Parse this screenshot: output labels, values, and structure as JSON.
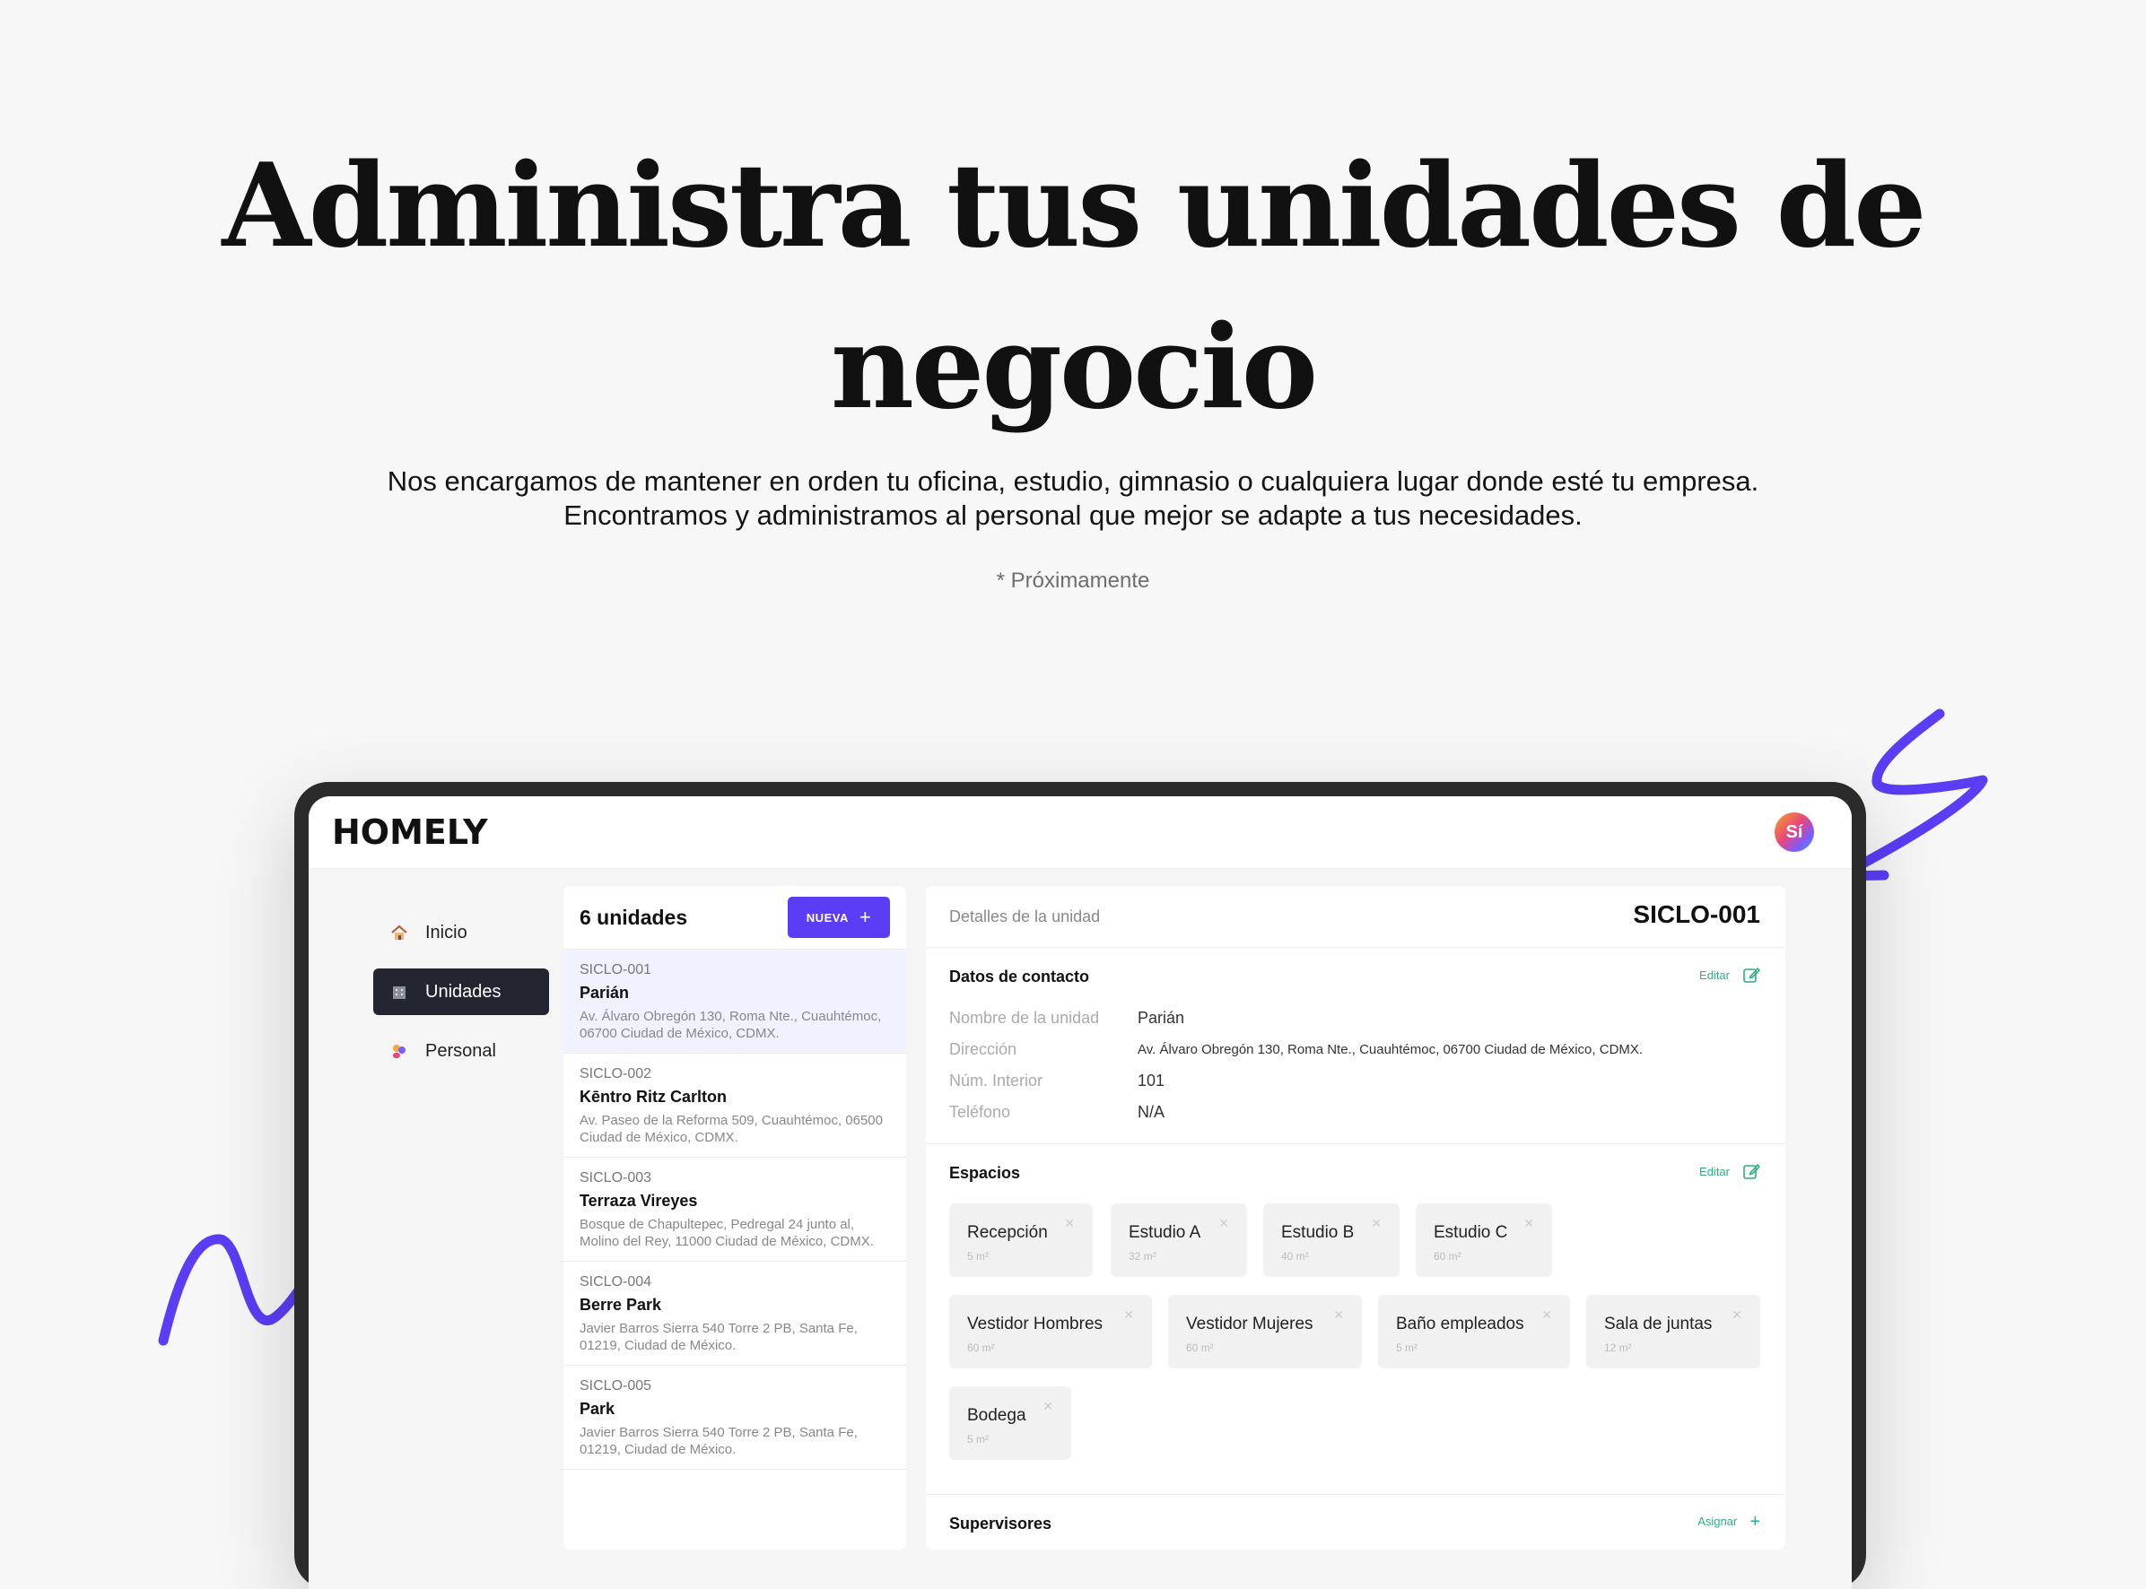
{
  "hero": {
    "title_line1": "Administra tus unidades de",
    "title_line2": "negocio",
    "subtitle_line1": "Nos encargamos de mantener en orden tu oficina, estudio, gimnasio o cualquiera lugar donde esté tu empresa.",
    "subtitle_line2": "Encontramos y administramos al personal que mejor se adapte a tus necesidades.",
    "note": "* Próximamente"
  },
  "app": {
    "logo": "HOMELY",
    "avatar": "Sí"
  },
  "sidebar": {
    "items": [
      {
        "label": "Inicio",
        "icon": "house-icon"
      },
      {
        "label": "Unidades",
        "icon": "building-icon",
        "active": true
      },
      {
        "label": "Personal",
        "icon": "people-icon"
      }
    ]
  },
  "list": {
    "count_label": "6 unidades",
    "new_button": "NUEVA",
    "units": [
      {
        "code": "SICLO-001",
        "name": "Parián",
        "address": "Av. Álvaro Obregón 130, Roma Nte., Cuauhtémoc, 06700 Ciudad de México, CDMX."
      },
      {
        "code": "SICLO-002",
        "name": "Kēntro Ritz Carlton",
        "address": "Av. Paseo de la Reforma 509, Cuauhtémoc, 06500 Ciudad de México, CDMX."
      },
      {
        "code": "SICLO-003",
        "name": "Terraza Vireyes",
        "address": "Bosque de Chapultepec, Pedregal 24 junto al, Molino del Rey, 11000 Ciudad de México, CDMX."
      },
      {
        "code": "SICLO-004",
        "name": "Berre Park",
        "address": "Javier Barros Sierra 540 Torre 2 PB, Santa Fe, 01219, Ciudad de México."
      },
      {
        "code": "SICLO-005",
        "name": "Park",
        "address": "Javier Barros Sierra 540 Torre 2 PB, Santa Fe, 01219, Ciudad de México."
      }
    ]
  },
  "detail": {
    "header_label": "Detalles de la unidad",
    "code": "SICLO-001",
    "contact": {
      "title": "Datos de contacto",
      "edit": "Editar",
      "rows": [
        {
          "k": "Nombre de la unidad",
          "v": "Parián"
        },
        {
          "k": "Dirección",
          "v": "Av. Álvaro Obregón 130, Roma Nte., Cuauhtémoc, 06700 Ciudad de México, CDMX."
        },
        {
          "k": "Núm. Interior",
          "v": "101"
        },
        {
          "k": "Teléfono",
          "v": "N/A"
        }
      ]
    },
    "spaces": {
      "title": "Espacios",
      "edit": "Editar",
      "items": [
        {
          "name": "Recepción",
          "size": "5 m²"
        },
        {
          "name": "Estudio A",
          "size": "32 m²"
        },
        {
          "name": "Estudio B",
          "size": "40 m²"
        },
        {
          "name": "Estudio C",
          "size": "60 m²"
        },
        {
          "name": "Vestidor Hombres",
          "size": "60 m²"
        },
        {
          "name": "Vestidor Mujeres",
          "size": "60 m²"
        },
        {
          "name": "Baño empleados",
          "size": "5 m²"
        },
        {
          "name": "Sala de juntas",
          "size": "12 m²"
        },
        {
          "name": "Bodega",
          "size": "5 m²"
        }
      ]
    },
    "supervisors": {
      "title": "Supervisores",
      "action": "Asignar"
    }
  },
  "colors": {
    "accent": "#5b3df5",
    "edit_green": "#2fae7f",
    "nav_active": "#232530",
    "arrow": "#5b3df5"
  }
}
